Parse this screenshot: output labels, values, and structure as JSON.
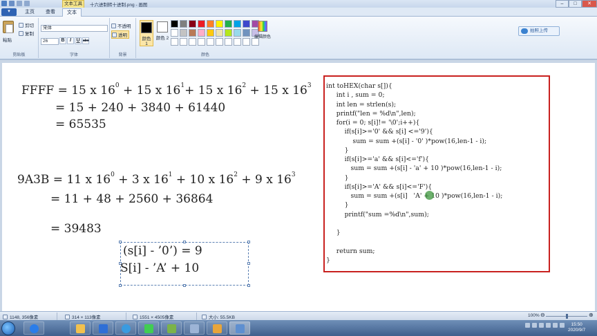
{
  "window": {
    "title": "十六进制转十进制.png - 画图",
    "context_tab": "文本工具",
    "controls": [
      "–",
      "□",
      "✕"
    ]
  },
  "ribbon_tabs": {
    "file": "▾",
    "items": [
      "主页",
      "查看",
      "文本"
    ],
    "active": "文本"
  },
  "clipboard": {
    "paste": "粘贴",
    "cut": "剪切",
    "copy": "复制",
    "label": "剪贴板"
  },
  "font": {
    "family": "宋体",
    "size": "26",
    "bold": "B",
    "italic": "I",
    "underline": "U",
    "strike": "abc",
    "label": "字体"
  },
  "background": {
    "opaque": "不透明",
    "transparent": "透明",
    "label": "背景"
  },
  "colors": {
    "color1_label": "颜色 1",
    "color2_label": "颜色 2",
    "color1": "#000000",
    "color2": "#ffffff",
    "edit_label": "编辑颜色",
    "label": "颜色",
    "palette": [
      "#000000",
      "#7f7f7f",
      "#880015",
      "#ed1c24",
      "#ff7f27",
      "#fff200",
      "#22b14c",
      "#00a2e8",
      "#3f48cc",
      "#a349a4",
      "#ffffff",
      "#c3c3c3",
      "#b97a57",
      "#ffaec9",
      "#ffc90e",
      "#efe4b0",
      "#b5e61d",
      "#99d9ea",
      "#7092be",
      "#c8bfe7",
      "#ffffff",
      "#ffffff",
      "#ffffff",
      "#ffffff",
      "#ffffff",
      "#ffffff",
      "#ffffff",
      "#ffffff",
      "#ffffff",
      "#ffffff"
    ]
  },
  "cloud_upload": "拍照上传",
  "canvas": {
    "eq1": {
      "line1_a": "FFFF = 15 x 16",
      "exp0": "0",
      "line1_b": "+ 15 x 16",
      "exp1": "1",
      "line1_c": "+ 15 x 16",
      "exp2": "2",
      "line1_d": "+ 15 x 16",
      "exp3": "3",
      "line2": "= 15 + 240 + 3840 + 61440",
      "line3": "= 65535"
    },
    "eq2": {
      "line1_a": "9A3B = 11 x 16",
      "exp0": "0",
      "line1_b": "+ 3 x 16",
      "exp1": "1",
      "line1_c": "+ 10 x 16",
      "exp2": "2",
      "line1_d": "+ 9 x 16",
      "exp3": "3",
      "line2": "= 11 + 48 + 2560 + 36864",
      "line3": "= 39483"
    },
    "textbox": {
      "line1": "(s[i] - ’0’) = 9",
      "line2": "S[i] - ’A’ + 10"
    },
    "code": [
      "int toHEX(char s[]){",
      "     int i , sum = 0;",
      "     int len = strlen(s);",
      "     printf(\"len = %d\\n\",len);",
      "     for(i = 0; s[i]!= '\\0';i++){",
      "         if(s[i]>='0' && s[i] <='9'){",
      "             sum = sum +(s[i] - '0' )*pow(16,len-1 - i);",
      "         }",
      "         if(s[i]>='a' && s[i]<='f'){",
      "            sum = sum +(s[i] - 'a' + 10 )*pow(16,len-1 - i);",
      "         }",
      "         if(s[i]>='A' && s[i]<='F'){",
      "            sum = sum +(s[i]   'A' + 10 )*pow(16,len-1 - i);",
      "         }",
      "         printf(\"sum =%d\\n\",sum);",
      "",
      "     }",
      "",
      "     return sum;",
      "}"
    ]
  },
  "status": {
    "cursor": "1148, 356像素",
    "selection": "314 × 113像素",
    "image_size": "1551 × 4505像素",
    "file_size": "大小: 55.5KB",
    "zoom": "100%",
    "zoom_level": 0.5
  },
  "taskbar": {
    "time": "15:50",
    "date": "2020/9/7",
    "apps": [
      "ie",
      "explorer",
      "app",
      "edge",
      "qt",
      "notepad",
      "calc",
      "video",
      "paint"
    ]
  }
}
